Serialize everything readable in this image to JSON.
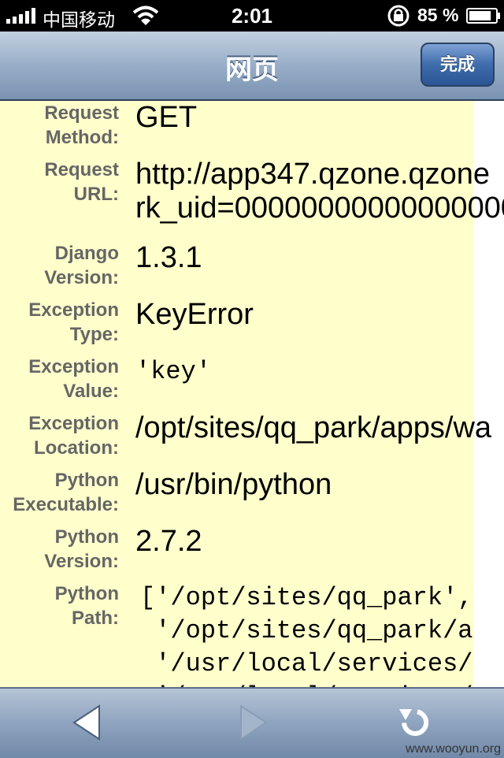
{
  "status_bar": {
    "carrier": "中国移动",
    "time": "2:01",
    "battery_percent": "85 %",
    "battery_level": 0.85
  },
  "nav": {
    "title": "网页",
    "done_label": "完成"
  },
  "page": {
    "rows": [
      {
        "label_1": "Request",
        "label_2": "Method:",
        "value": "GET"
      },
      {
        "label_1": "Request",
        "label_2": "URL:",
        "value_1": "http://app347.qzone.qzone",
        "value_2": "rk_uid=00000000000000000"
      },
      {
        "label_1": "Django",
        "label_2": "Version:",
        "value": "1.3.1"
      },
      {
        "label_1": "Exception",
        "label_2": "Type:",
        "value": "KeyError"
      },
      {
        "label_1": "Exception",
        "label_2": "Value:",
        "value": "'key'"
      },
      {
        "label_1": "Exception",
        "label_2": "Location:",
        "value": "/opt/sites/qq_park/apps/wa"
      },
      {
        "label_1": "Python",
        "label_2": "Executable:",
        "value": "/usr/bin/python"
      },
      {
        "label_1": "Python",
        "label_2": "Version:",
        "value": "2.7.2"
      },
      {
        "label_1": "Python",
        "label_2": "Path:",
        "value_lines": [
          "['/opt/sites/qq_park',",
          " '/opt/sites/qq_park/a",
          " '/usr/local/services/",
          " '/usr/local/services/"
        ]
      }
    ]
  },
  "toolbar": {
    "back_icon": "back-arrow-icon",
    "forward_icon": "forward-arrow-icon",
    "reload_icon": "reload-icon"
  },
  "watermark": "www.wooyun.org"
}
